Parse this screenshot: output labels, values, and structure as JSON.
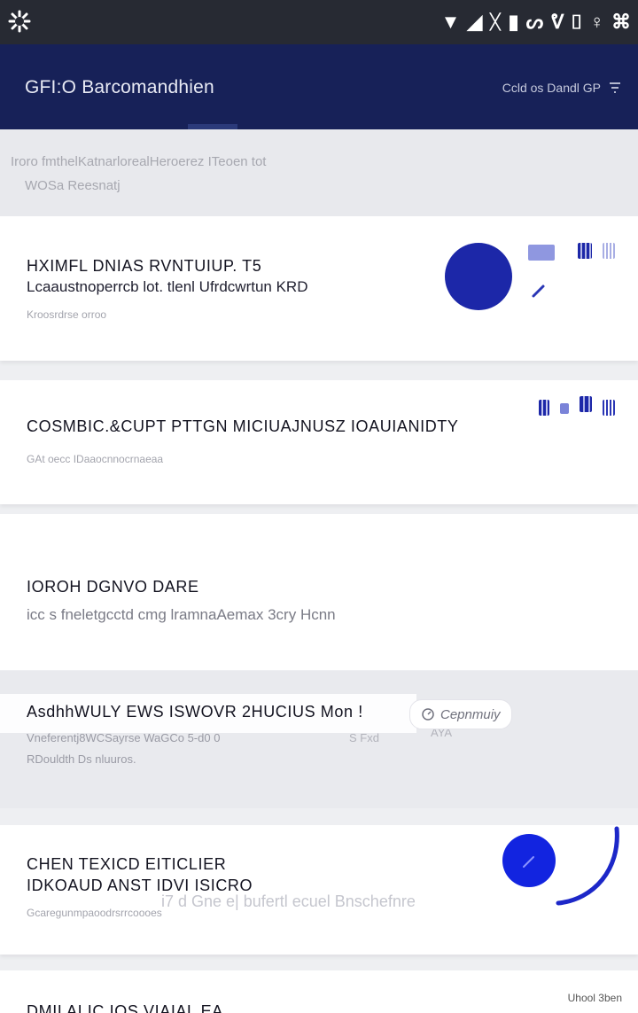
{
  "status_bar": {
    "icons": [
      "settings-icon",
      "wifi-icon",
      "signal-icon",
      "nfc-icon",
      "battery-icon",
      "network-icon",
      "vibrate-icon",
      "sim-icon",
      "location-icon",
      "notification-icon"
    ],
    "glyphs": [
      "▼",
      "◢",
      "ᚷ",
      "▮",
      "ᔕ",
      "ᕓ",
      "⌷",
      "♀",
      "⌘"
    ]
  },
  "app_bar": {
    "title": "GFI:O  Barcomandhien",
    "right_text": "Ccld os Dandl GP",
    "background": "#172158"
  },
  "notice": {
    "line1": "Iroro fmthelKatnarlorealHeroerez ITeoen tot",
    "line2": "WOSa Reesnatj"
  },
  "cards": [
    {
      "title": "HXIMFL DNIAS RVNTUIUP. T5",
      "subtitle": "Lcaaustnoperrcb lot.  tlenl Ufrdcwrtun KRD",
      "meta": "Kroosrdrse orroo"
    },
    {
      "title": "COSMBIC.&CUPT PTTGN MICIUAJNUSZ IOAUIANIDTY",
      "meta": "GAt oecc IDaaocnnocrnaeaa"
    },
    {
      "title": "IOROH DGNVO      DARE",
      "subtitle": "icc s fneletgcctd cmg lramnaAemax 3cry Hcnn"
    },
    {
      "title": "AsdhhWULY EWS ISWOVR 2HUCIUS  Mon  !",
      "meta_line1": "Vneferentj8WCSayrse  WaGCo  5-d0 0",
      "meta_line2": "RDouldth Ds nluuros.",
      "meta_right": "S Fxd",
      "meta_right2": "AYA",
      "chip_label": "Cepnmuiy"
    },
    {
      "title_line1": "CHEN TEXICD EITICLIER",
      "title_line2": "IDKOAUD ANST  IDVI ISICRO",
      "overlay": "i7 d Gne e| bufertl ecuel Bnschefnre",
      "meta": "Gcaregunmpaoodrsrrcoooes"
    }
  ],
  "footer": {
    "title": "DMII AI IC  IOS VIAIAL EA",
    "corner": "Uhool 3ben"
  },
  "colors": {
    "accent": "#1c27a8",
    "status_bar": "#272a33",
    "background": "#eeeff2"
  }
}
